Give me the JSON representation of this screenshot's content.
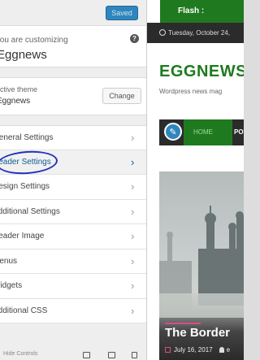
{
  "toolbar": {
    "saved_label": "Saved"
  },
  "customizing": {
    "caption": "You are customizing",
    "site_name": "Eggnews",
    "help_icon": "question-icon"
  },
  "theme": {
    "caption": "Active theme",
    "name": "Eggnews",
    "change_label": "Change"
  },
  "menu": {
    "items": [
      {
        "label": "General Settings"
      },
      {
        "label": "Header Settings"
      },
      {
        "label": "Design Settings"
      },
      {
        "label": "Additional Settings"
      },
      {
        "label": "Header Image"
      },
      {
        "label": "Menus"
      },
      {
        "label": "Widgets"
      },
      {
        "label": "Additional CSS"
      }
    ],
    "active_index": 1
  },
  "footer": {
    "label": "Hide Controls"
  },
  "preview": {
    "flash_label": "Flash :",
    "date": "Tuesday, October 24,",
    "logo": "EGGNEWS",
    "tagline": "Wordpress news mag",
    "nav_home": "HOME",
    "nav_next": "PO",
    "hero_title": "The Border",
    "hero_date": "July 16, 2017",
    "hero_author": "e"
  },
  "colors": {
    "accent_blue": "#2f86bd",
    "brand_green": "#1f7a1f",
    "dark_bar": "#2b2b2b",
    "annotation_circle": "#2233bb"
  }
}
